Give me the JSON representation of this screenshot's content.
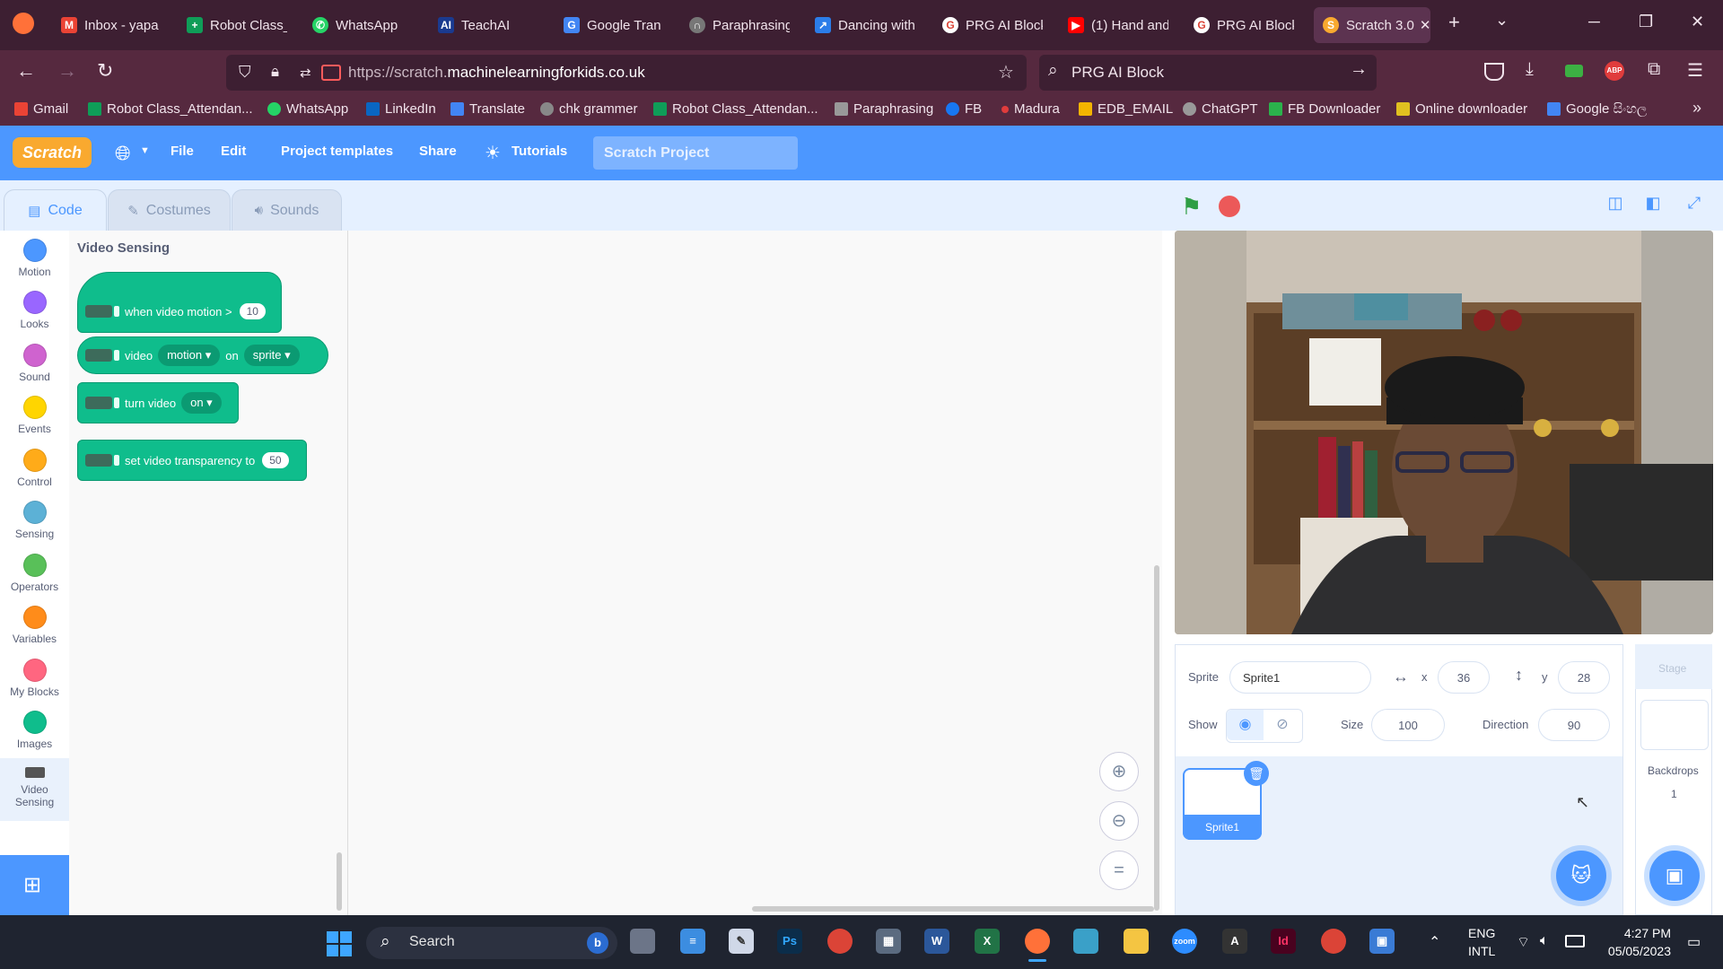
{
  "browser": {
    "tabs": [
      "Inbox - yapa",
      "Robot Class_",
      "WhatsApp",
      "TeachAI",
      "Google Tran",
      "Paraphrasing",
      "Dancing with",
      "PRG AI Block",
      "(1) Hand and",
      "PRG AI Block",
      "Scratch 3.0"
    ],
    "url_prefix": "https://scratch.",
    "url_domain": "machinelearningforkids.co.uk",
    "search_text": "PRG AI Block",
    "bookmarks": [
      "Gmail",
      "Robot Class_Attendan...",
      "WhatsApp",
      "LinkedIn",
      "Translate",
      "chk grammer",
      "Robot Class_Attendan...",
      "Paraphrasing",
      "FB",
      "Madura",
      "EDB_EMAIL",
      "ChatGPT",
      "FB Downloader",
      "Online downloader",
      "Google සිංහල"
    ]
  },
  "scratch": {
    "logo": "Scratch",
    "menu": {
      "file": "File",
      "edit": "Edit",
      "templates": "Project templates",
      "share": "Share",
      "tutorials": "Tutorials"
    },
    "project_title": "Scratch Project",
    "tabs": {
      "code": "Code",
      "costumes": "Costumes",
      "sounds": "Sounds"
    },
    "categories": [
      {
        "label": "Motion",
        "color": "#4c97ff"
      },
      {
        "label": "Looks",
        "color": "#9966ff"
      },
      {
        "label": "Sound",
        "color": "#cf63cf"
      },
      {
        "label": "Events",
        "color": "#ffd500"
      },
      {
        "label": "Control",
        "color": "#ffab19"
      },
      {
        "label": "Sensing",
        "color": "#5cb1d6"
      },
      {
        "label": "Operators",
        "color": "#59c059"
      },
      {
        "label": "Variables",
        "color": "#ff8c1a"
      },
      {
        "label": "My Blocks",
        "color": "#ff6680"
      },
      {
        "label": "Images",
        "color": "#0fbd8c"
      }
    ],
    "video_category": {
      "label_1": "Video",
      "label_2": "Sensing"
    },
    "flyout_title": "Video Sensing",
    "blocks": {
      "when_motion": "when video motion >",
      "when_motion_value": "10",
      "video_label": "video",
      "video_attr": "motion",
      "video_on": "on",
      "video_target": "sprite",
      "turn_video": "turn video",
      "turn_value": "on",
      "set_transparency": "set video transparency to",
      "transparency_value": "50"
    },
    "sprite_info": {
      "sprite_label": "Sprite",
      "sprite_name": "Sprite1",
      "x_label": "x",
      "x_value": "36",
      "y_label": "y",
      "y_value": "28",
      "show_label": "Show",
      "size_label": "Size",
      "size_value": "100",
      "direction_label": "Direction",
      "direction_value": "90"
    },
    "sprite_thumb_label": "Sprite1",
    "stage_panel": {
      "title": "Stage",
      "backdrops_label": "Backdrops",
      "backdrops_count": "1"
    }
  },
  "taskbar": {
    "search": "Search",
    "lang_1": "ENG",
    "lang_2": "INTL",
    "time": "4:27 PM",
    "date": "05/05/2023"
  }
}
